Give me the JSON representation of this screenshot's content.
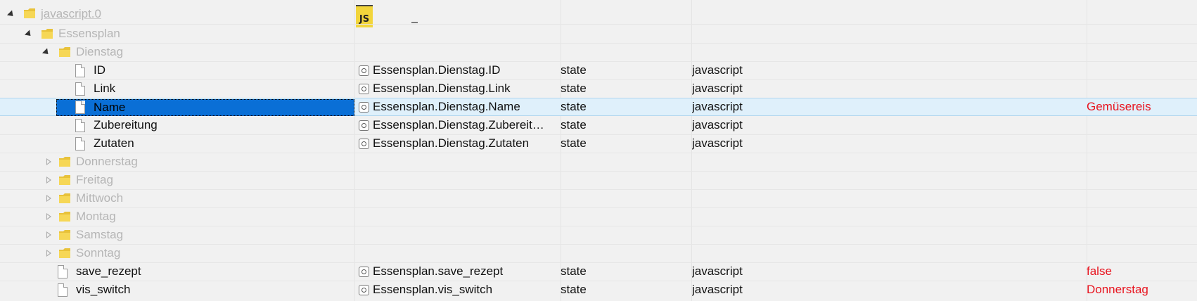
{
  "tree": {
    "root": {
      "label": "javascript.0"
    },
    "group": {
      "label": "Essensplan"
    },
    "day": {
      "label": "Dienstag"
    },
    "rows": [
      {
        "label": "ID",
        "id": "Essensplan.Dienstag.ID",
        "type": "state",
        "role": "javascript",
        "value": ""
      },
      {
        "label": "Link",
        "id": "Essensplan.Dienstag.Link",
        "type": "state",
        "role": "javascript",
        "value": ""
      },
      {
        "label": "Name",
        "id": "Essensplan.Dienstag.Name",
        "type": "state",
        "role": "javascript",
        "value": "Gemüsereis"
      },
      {
        "label": "Zubereitung",
        "id": "Essensplan.Dienstag.Zubereit…",
        "type": "state",
        "role": "javascript",
        "value": ""
      },
      {
        "label": "Zutaten",
        "id": "Essensplan.Dienstag.Zutaten",
        "type": "state",
        "role": "javascript",
        "value": ""
      }
    ],
    "collapsed_days": [
      "Donnerstag",
      "Freitag",
      "Mittwoch",
      "Montag",
      "Samstag",
      "Sonntag"
    ],
    "states": [
      {
        "label": "save_rezept",
        "id": "Essensplan.save_rezept",
        "type": "state",
        "role": "javascript",
        "value": "false"
      },
      {
        "label": "vis_switch",
        "id": "Essensplan.vis_switch",
        "type": "state",
        "role": "javascript",
        "value": "Donnerstag"
      }
    ]
  },
  "header_extra": {
    "cursor": "_"
  },
  "icons": {
    "folder": "folder-icon",
    "file": "file-icon",
    "state": "state-icon",
    "js": "js-logo-icon"
  },
  "colors": {
    "selection": "#0a6fd6",
    "value": "#e8141f",
    "muted": "#b5b5b5"
  }
}
